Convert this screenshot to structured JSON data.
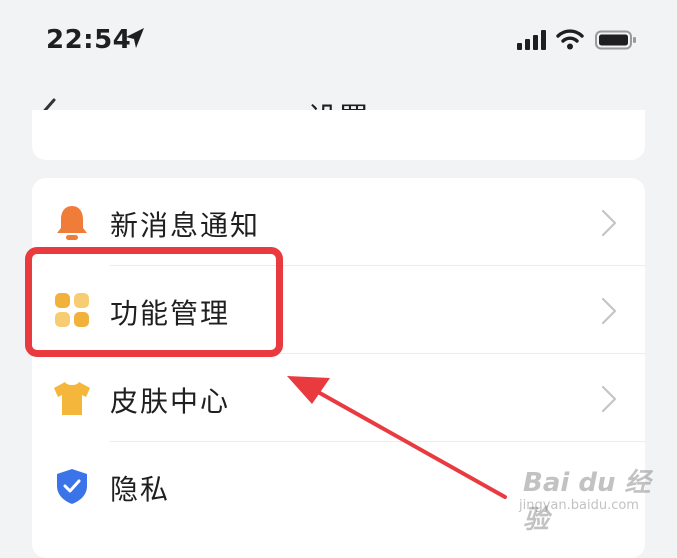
{
  "status_bar": {
    "time": "22:54",
    "icons": [
      "location-arrow-icon",
      "cellular-signal-icon",
      "wifi-icon",
      "battery-icon"
    ]
  },
  "nav": {
    "title": "设置",
    "back_icon": "chevron-left-icon"
  },
  "settings": [
    {
      "label": "新消息通知",
      "icon": "bell-icon",
      "color": "#f07c3a"
    },
    {
      "label": "功能管理",
      "icon": "grid-icon",
      "color": "#f2b13a"
    },
    {
      "label": "皮肤中心",
      "icon": "tshirt-icon",
      "color": "#f5b73b"
    },
    {
      "label": "隐私",
      "icon": "shield-check-icon",
      "color": "#3b74e8"
    }
  ],
  "annotation": {
    "highlight_color": "#e83a3f",
    "highlighted_item": "功能管理"
  },
  "watermark": {
    "brand": "Bai du 经验",
    "url": "jingyan.baidu.com"
  },
  "colors": {
    "background": "#f2f3f5",
    "card": "#ffffff",
    "chevron": "#c5c5c5"
  }
}
